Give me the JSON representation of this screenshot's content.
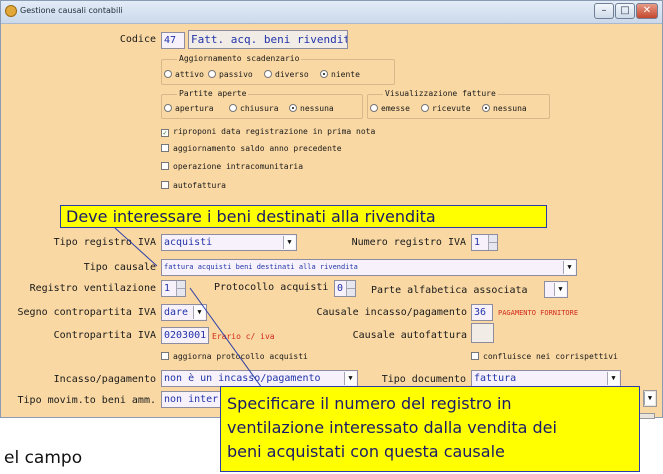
{
  "window": {
    "title": "Gestione causali contabili",
    "controls": {
      "minimize": "–",
      "maximize": "□",
      "close": "✕"
    }
  },
  "codice": {
    "label": "Codice",
    "value": "47",
    "description": "Fatt. acq. beni rivendita"
  },
  "aggiornamento_scadenzario": {
    "title": "Aggiornamento scadenzario",
    "options": [
      "attivo",
      "passivo",
      "diverso",
      "niente"
    ],
    "selected": "niente"
  },
  "partite_aperte": {
    "title": "Partite aperte",
    "options": [
      "apertura",
      "chiusura",
      "nessuna"
    ],
    "selected": "nessuna"
  },
  "visualizzazione_fatture": {
    "title": "Visualizzazione fatture",
    "options": [
      "emesse",
      "ricevute",
      "nessuna"
    ],
    "selected": "nessuna"
  },
  "checks": {
    "riproponi": {
      "label": "riproponi data registrazione in prima nota",
      "checked": true
    },
    "aggiornamento_saldo": {
      "label": "aggiornamento saldo anno precedente",
      "checked": false
    },
    "intracomunitaria": {
      "label": "operazione intracomunitaria",
      "checked": false
    },
    "autofattura": {
      "label": "autofattura",
      "checked": false
    },
    "aggiorna_protocollo": {
      "label": "aggiorna protocollo acquisti",
      "checked": false
    },
    "confluisce": {
      "label": "confluisce nei corrispettivi",
      "checked": false
    }
  },
  "tooltip_top": "Deve interessare i beni destinati alla rivendita",
  "tipo_registro_iva": {
    "label": "Tipo registro IVA",
    "value": "acquisti"
  },
  "numero_registro_iva": {
    "label": "Numero registro IVA",
    "value": "1"
  },
  "tipo_causale": {
    "label": "Tipo causale",
    "value": "fattura acquisti beni destinati alla rivendita"
  },
  "registro_ventilazione": {
    "label": "Registro ventilazione",
    "value": "1"
  },
  "protocollo_acquisti": {
    "label": "Protocollo acquisti",
    "value": "0"
  },
  "parte_alfabetica": {
    "label": "Parte alfabetica associata",
    "value": ""
  },
  "segno_contropartita": {
    "label": "Segno contropartita IVA",
    "value": "dare"
  },
  "causale_incasso": {
    "label": "Causale incasso/pagamento",
    "value": "36",
    "description": "PAGAMENTO FORNITORE"
  },
  "contropartita_iva": {
    "label": "Contropartita IVA",
    "value": "0203001",
    "description": "Erario c/ iva"
  },
  "causale_autofattura": {
    "label": "Causale autofattura",
    "value": ""
  },
  "incasso_pagamento": {
    "label": "Incasso/pagamento",
    "value": "non è un incasso/pagamento"
  },
  "tipo_documento": {
    "label": "Tipo documento",
    "value": "fattura"
  },
  "tipo_movim_beni": {
    "label": "Tipo movim.to beni amm.",
    "value": "non inter"
  },
  "tooltip_bottom": {
    "line1": "Specificare il numero del registro in",
    "line2": "ventilazione interessato dalla vendita dei",
    "line3": "beni acquistati con questa causale"
  },
  "bottom_text": "el campo"
}
